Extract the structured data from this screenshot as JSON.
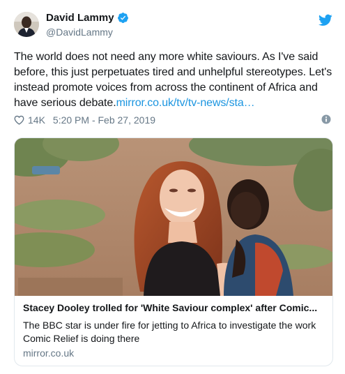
{
  "author": {
    "name": "David Lammy",
    "handle": "@DavidLammy",
    "verified": true
  },
  "tweet": {
    "text": "The world does not need any more white saviours. As I've said before, this just perpetuates tired and unhelpful stereotypes. Let's instead promote voices from across the continent of Africa and have serious debate.",
    "link_text": "mirror.co.uk/tv/tv-news/sta…",
    "likes": "14K",
    "timestamp": "5:20 PM - Feb 27, 2019"
  },
  "card": {
    "title": "Stacey Dooley trolled for 'White Saviour complex' after Comic...",
    "description": "The BBC star is under fire for jetting to Africa to investigate the work Comic Relief is doing there",
    "domain": "mirror.co.uk"
  },
  "colors": {
    "link": "#1b95e0",
    "verified_badge": "#1da1f2",
    "twitter_bird": "#1da1f2",
    "meta_text": "#657786"
  },
  "icons": {
    "verified": "verified-badge-icon",
    "bird": "twitter-bird-icon",
    "like": "heart-icon",
    "info": "info-icon"
  }
}
